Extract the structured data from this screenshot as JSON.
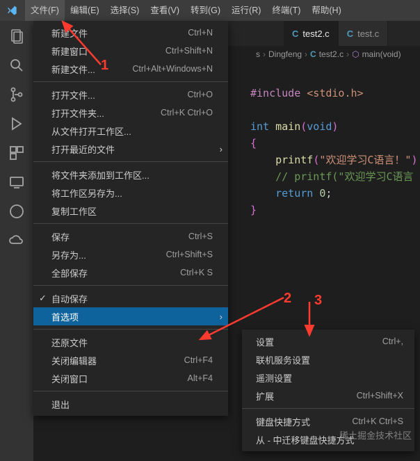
{
  "menubar": {
    "items": [
      "文件(F)",
      "编辑(E)",
      "选择(S)",
      "查看(V)",
      "转到(G)",
      "运行(R)",
      "终端(T)",
      "帮助(H)"
    ]
  },
  "tabs": [
    {
      "icon": "C",
      "label": "test2.c",
      "active": true
    },
    {
      "icon": "C",
      "label": "test.c",
      "active": false
    }
  ],
  "breadcrumb": {
    "seg0": "s",
    "seg1": "Dingfeng",
    "seg2": "test2.c",
    "seg3": "main(void)"
  },
  "code": {
    "l1a": "#include",
    "l1b": " <stdio.h>",
    "l3a": "int ",
    "l3b": "main",
    "l3c": "(",
    "l3d": "void",
    "l3e": ")",
    "l4": "{",
    "l5a": "    printf",
    "l5b": "(",
    "l5c": "\"欢迎学习C语言！\"",
    "l5d": ")",
    "l6": "    // printf(\"欢迎学习C语言",
    "l7a": "    return ",
    "l7b": "0",
    "l7c": ";",
    "l8": "}"
  },
  "filemenu": [
    {
      "label": "新建文件",
      "kb": "Ctrl+N"
    },
    {
      "label": "新建窗口",
      "kb": "Ctrl+Shift+N"
    },
    {
      "label": "新建文件...",
      "kb": "Ctrl+Alt+Windows+N"
    },
    {
      "sep": true
    },
    {
      "label": "打开文件...",
      "kb": "Ctrl+O"
    },
    {
      "label": "打开文件夹...",
      "kb": "Ctrl+K Ctrl+O"
    },
    {
      "label": "从文件打开工作区..."
    },
    {
      "label": "打开最近的文件",
      "submenu": true
    },
    {
      "sep": true
    },
    {
      "label": "将文件夹添加到工作区..."
    },
    {
      "label": "将工作区另存为..."
    },
    {
      "label": "复制工作区"
    },
    {
      "sep": true
    },
    {
      "label": "保存",
      "kb": "Ctrl+S"
    },
    {
      "label": "另存为...",
      "kb": "Ctrl+Shift+S"
    },
    {
      "label": "全部保存",
      "kb": "Ctrl+K S"
    },
    {
      "sep": true
    },
    {
      "label": "自动保存",
      "check": true
    },
    {
      "label": "首选项",
      "submenu": true,
      "highlight": true
    },
    {
      "sep": true
    },
    {
      "label": "还原文件"
    },
    {
      "label": "关闭编辑器",
      "kb": "Ctrl+F4"
    },
    {
      "label": "关闭窗口",
      "kb": "Alt+F4"
    },
    {
      "sep": true
    },
    {
      "label": "退出"
    }
  ],
  "prefmenu": [
    {
      "label": "设置",
      "kb": "Ctrl+,"
    },
    {
      "label": "联机服务设置"
    },
    {
      "label": "遥测设置"
    },
    {
      "label": "扩展",
      "kb": "Ctrl+Shift+X"
    },
    {
      "sep": true
    },
    {
      "label": "键盘快捷方式",
      "kb": "Ctrl+K Ctrl+S"
    },
    {
      "label": "从 - 中迁移键盘快捷方式"
    }
  ],
  "anno": {
    "n1": "1",
    "n2": "2",
    "n3": "3"
  },
  "watermark": "稀土掘金技术社区"
}
